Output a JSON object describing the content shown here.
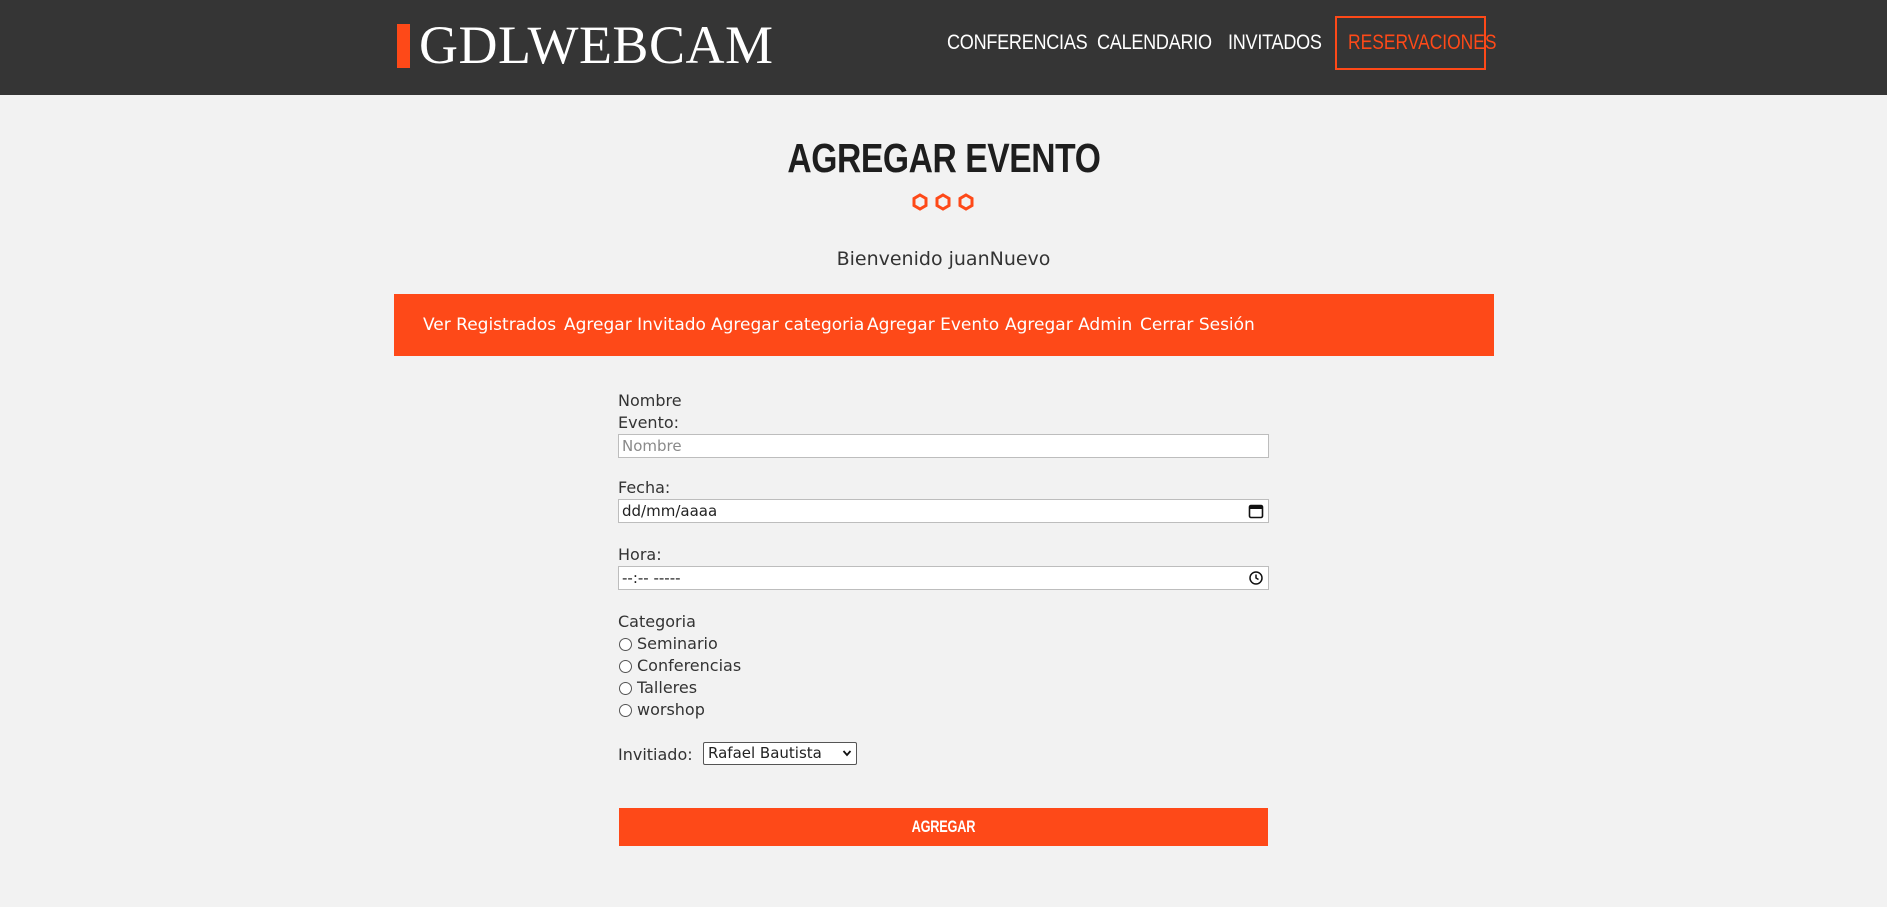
{
  "header": {
    "logo": "GDLWEBCAM",
    "nav": [
      {
        "label": "CONFERENCIAS"
      },
      {
        "label": "CALENDARIO"
      },
      {
        "label": "INVITADOS"
      },
      {
        "label": "RESERVACIONES"
      }
    ]
  },
  "page": {
    "title": "AGREGAR EVENTO",
    "welcome": "Bienvenido juanNuevo"
  },
  "admin_menu": [
    {
      "label": "Ver Registrados"
    },
    {
      "label": "Agregar Invitado"
    },
    {
      "label": "Agregar categoria"
    },
    {
      "label": "Agregar Evento"
    },
    {
      "label": "Agregar Admin"
    },
    {
      "label": "Cerrar Sesión"
    }
  ],
  "form": {
    "name_label_1": "Nombre",
    "name_label_2": "Evento:",
    "name_placeholder": "Nombre",
    "name_value": "",
    "date_label": "Fecha:",
    "date_value": "dd/mm/aaaa",
    "time_label": "Hora:",
    "time_value": "--:-- -----",
    "category_label": "Categoria",
    "categories": [
      {
        "label": "Seminario",
        "checked": false
      },
      {
        "label": "Conferencias",
        "checked": false
      },
      {
        "label": "Talleres",
        "checked": false
      },
      {
        "label": "worshop",
        "checked": false
      }
    ],
    "guest_label": "Invitiado:",
    "guest_selected": "Rafael Bautista",
    "submit_label": "AGREGAR"
  },
  "colors": {
    "accent": "#fe4918",
    "header_bg": "#353535",
    "page_bg": "#f2f2f2"
  }
}
